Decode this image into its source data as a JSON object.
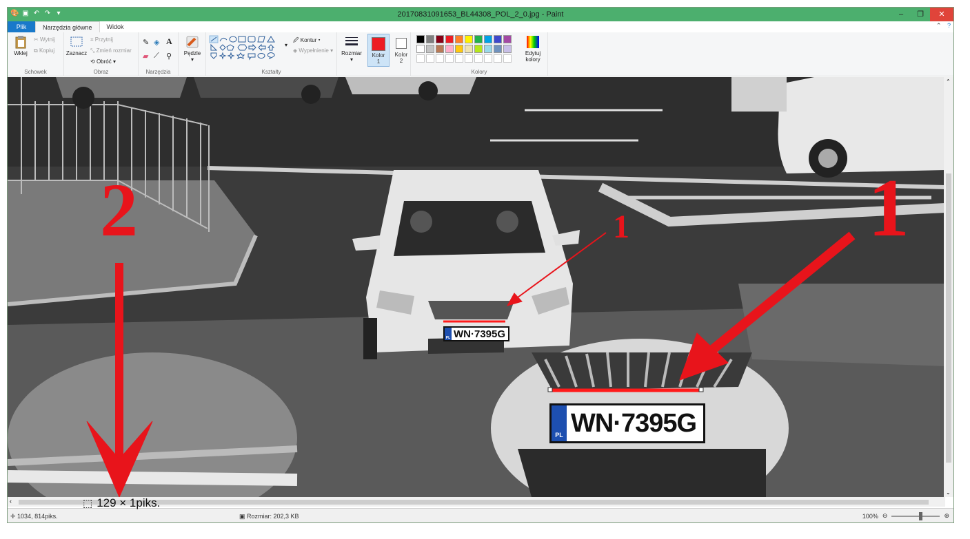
{
  "window": {
    "title": "20170831091653_BL44308_POL_2_0.jpg - Paint",
    "minimize": "–",
    "maximize": "❐",
    "close": "✕"
  },
  "tabs": [
    {
      "label": "Plik"
    },
    {
      "label": "Narzędzia główne"
    },
    {
      "label": "Widok"
    }
  ],
  "ribbon": {
    "clipboard": {
      "paste": "Wklej",
      "cut": "Wytnij",
      "copy": "Kopiuj",
      "group": "Schowek"
    },
    "image": {
      "select": "Zaznacz",
      "crop": "Przytnij",
      "resize": "Zmień rozmiar",
      "rotate": "Obróć",
      "group": "Obraz"
    },
    "tools": {
      "group": "Narzędzia"
    },
    "brushes": {
      "label": "Pędzle"
    },
    "shapes": {
      "outline": "Kontur",
      "fill": "Wypełnienie",
      "group": "Kształty"
    },
    "size": {
      "label": "Rozmiar"
    },
    "color1": {
      "label": "Kolor",
      "num": "1"
    },
    "color2": {
      "label": "Kolor",
      "num": "2"
    },
    "colors": {
      "group": "Kolory",
      "edit": "Edytuj",
      "edit2": "kolory"
    },
    "palette": [
      "#000000",
      "#7f7f7f",
      "#880015",
      "#ed1c24",
      "#ff7f27",
      "#fff200",
      "#22b14c",
      "#00a2e8",
      "#3f48cc",
      "#a349a4",
      "#ffffff",
      "#c3c3c3",
      "#b97a57",
      "#ffaec9",
      "#ffc90e",
      "#efe4b0",
      "#b5e61d",
      "#99d9ea",
      "#7092be",
      "#c8bfe7"
    ],
    "active_color": "#ed1c24"
  },
  "photo": {
    "label_small": "1",
    "label_big": "1",
    "label_left": "2",
    "plate_text": "WN·7395G",
    "plate_eu": "PL"
  },
  "status": {
    "cursor": "1034, 814piks.",
    "selection": "129 × 1piks.",
    "size": "Rozmiar: 202,3 KB",
    "zoom": "100%"
  }
}
